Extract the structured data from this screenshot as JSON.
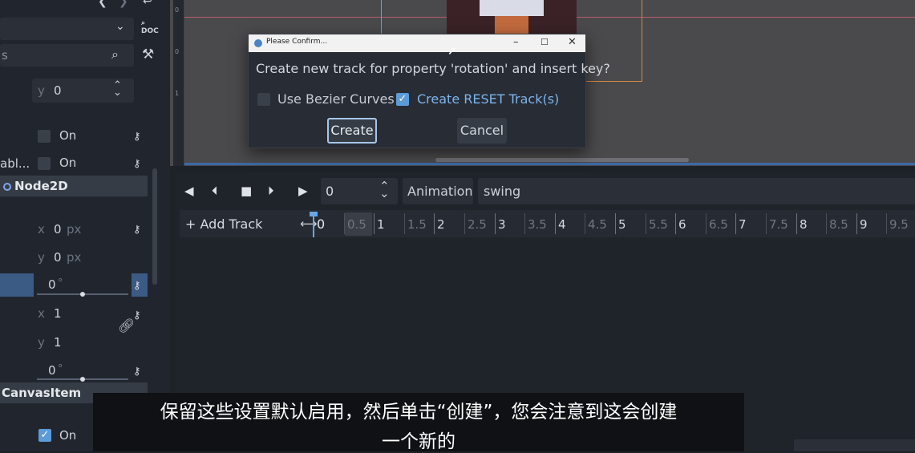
{
  "inspector": {
    "rows": [
      {
        "axis": "y",
        "value": "0"
      },
      {
        "toggle": "On"
      },
      {
        "label": "abl...",
        "toggle": "On"
      },
      {
        "axis": "x",
        "value": "0",
        "unit": "px"
      },
      {
        "axis": "y",
        "value": "0",
        "unit": "px"
      },
      {
        "value": "0",
        "unit": "°"
      },
      {
        "axis": "x",
        "value": "1"
      },
      {
        "axis": "y",
        "value": "1"
      },
      {
        "value": "0",
        "unit": "°"
      },
      {
        "toggle": "On"
      }
    ],
    "filter_placeholder": "s",
    "section_node2d": "Node2D",
    "section_canvasitem": "CanvasItem"
  },
  "viewport": {
    "ruler_marks": [
      "0",
      "0",
      "1"
    ]
  },
  "dialog": {
    "title": "Please Confirm...",
    "message": "Create new track for property 'rotation' and insert key?",
    "use_bezier_label": "Use Bezier Curves",
    "use_bezier_checked": false,
    "create_reset_label": "Create RESET Track(s)",
    "create_reset_checked": true,
    "create_label": "Create",
    "cancel_label": "Cancel"
  },
  "animation": {
    "frame_value": "0",
    "animation_label": "Animation",
    "animation_name": "swing",
    "add_track_label": "+ Add Track",
    "timeline_labels": [
      "0",
      "0.5",
      "1",
      "1.5",
      "2",
      "2.5",
      "3",
      "3.5",
      "4",
      "4.5",
      "5",
      "5.5",
      "6",
      "6.5",
      "7",
      "7.5",
      "8",
      "8.5",
      "9",
      "9.5"
    ]
  },
  "subtitles": {
    "line1": "保留这些设置默认启用，然后单击“创建”，您会注意到这会创建",
    "line2": "一个新的"
  },
  "colors": {
    "accent": "#5b9bd8",
    "orange": "#d6893d"
  }
}
